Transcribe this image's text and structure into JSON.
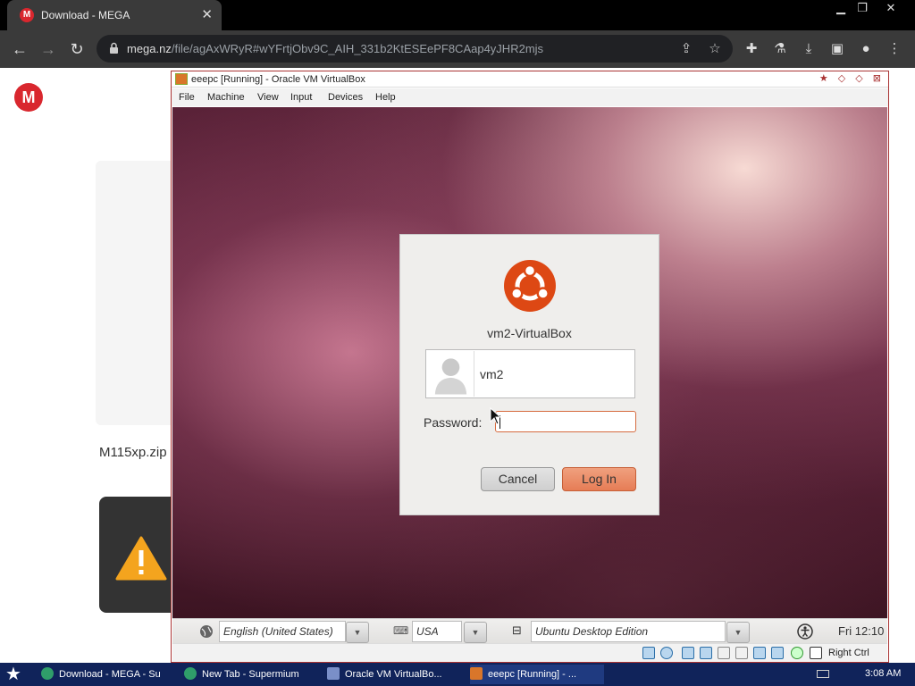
{
  "browser": {
    "tab_title": "Download - MEGA",
    "tab_favicon_letter": "M",
    "url_host": "mega.nz",
    "url_path": "/file/agAxWRyR#wYFrtjObv9C_AIH_331b2KtESEePF8CAap4yJHR2mjs"
  },
  "mega": {
    "logo_letter": "M",
    "filename": "M115xp.zip",
    "warning_icon": "warning-icon"
  },
  "vbox": {
    "title": "eeepc [Running] - Oracle VM VirtualBox",
    "menu": [
      "File",
      "Machine",
      "View",
      "Input",
      "Devices",
      "Help"
    ],
    "host_key": "Right Ctrl"
  },
  "login": {
    "hostname": "vm2-VirtualBox",
    "username": "vm2",
    "password_label": "Password:",
    "password_value": "",
    "cancel_label": "Cancel",
    "login_label": "Log In"
  },
  "vm_bar": {
    "language": "English (United States)",
    "keyboard": "USA",
    "session": "Ubuntu Desktop Edition",
    "clock": "Fri 12:10"
  },
  "taskbar": {
    "tasks": [
      "Download - MEGA - Su",
      "New Tab - Supermium",
      "Oracle VM VirtualBo...",
      "eeepc [Running] - ..."
    ],
    "time": "3:08 AM"
  },
  "colors": {
    "mega_red": "#d9272e",
    "ubuntu_orange": "#dd4814",
    "taskbar": "#10235a"
  }
}
